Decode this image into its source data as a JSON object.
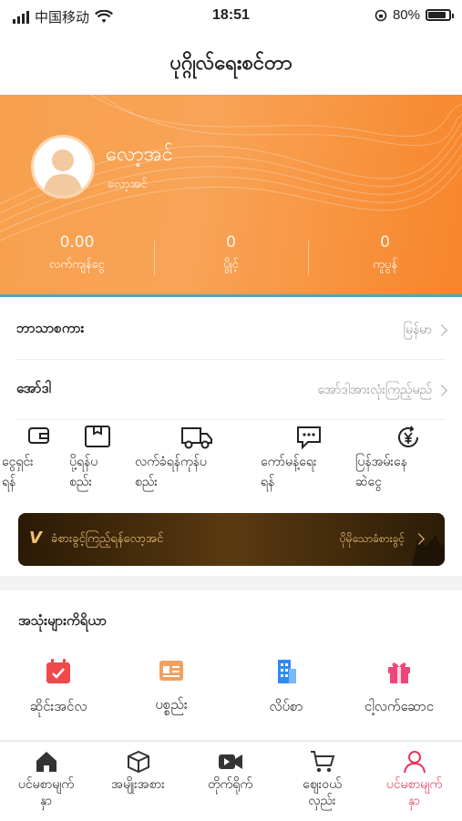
{
  "status": {
    "carrier": "中国移动",
    "time": "18:51",
    "battery": "80%"
  },
  "header": {
    "title": "ပုဂ္ဂိုလ်ရေးစင်တာ"
  },
  "profile": {
    "name": "လော့အင်",
    "subname": "လော့အင်"
  },
  "stats": [
    {
      "value": "0.00",
      "label": "လက်ကျန်ငွေ"
    },
    {
      "value": "0",
      "label": "ပွိုင့်"
    },
    {
      "value": "0",
      "label": "ကူပွန်"
    }
  ],
  "settings": {
    "language_label": "ဘာသာစကား",
    "language_value": "မြန်မာ",
    "order_label": "အော်ဒါ",
    "order_value": "အော်ဒါအားလုံးကြည့်မည်"
  },
  "tools": [
    {
      "label": "ငွေရှင်း\nရန်",
      "icon": "wallet-icon"
    },
    {
      "label": "ပို့ရန်ပ\nစည်း",
      "icon": "package-icon"
    },
    {
      "label": "လက်ခံရန်ကုန်ပ\nစည်း",
      "icon": "truck-icon"
    },
    {
      "label": "ကော်မန့်ရေး\nရန်",
      "icon": "comment-icon"
    },
    {
      "label": "ပြန်အမ်းနေ\nဆဲငွေ",
      "icon": "refund-yen-icon"
    }
  ],
  "vip": {
    "badge": "V",
    "text": "ခံစားခွင့်ကြည့်ရန်လော့အင်",
    "link": "ပိုမိုသောခံစားခွင့်"
  },
  "common_tools": {
    "title": "အသုံးများကိရိယာ",
    "items": [
      {
        "label": "ဆိုင်းအင်လ",
        "icon": "calendar-check-icon",
        "color": "#f0494b"
      },
      {
        "label": "ပစ္စည်း",
        "icon": "id-card-icon",
        "color": "#f0a060"
      },
      {
        "label": "လိပ်စာ",
        "icon": "building-icon",
        "color": "#2f8cf3"
      },
      {
        "label": "ငါ့လက်ဆောင",
        "icon": "gift-icon",
        "color": "#f0457a"
      }
    ]
  },
  "tabbar": [
    {
      "label": "ပင်မစာမျက်\nနှာ",
      "icon": "home-icon",
      "active": false
    },
    {
      "label": "အမျိုးအစား",
      "icon": "cube-icon",
      "active": false
    },
    {
      "label": "တိုက်ရိုက်",
      "icon": "video-icon",
      "active": false
    },
    {
      "label": "ဈေးဝယ်\nလှည်း",
      "icon": "cart-icon",
      "active": false
    },
    {
      "label": "ပင်မစာမျက်\nနှာ",
      "icon": "profile-icon",
      "active": true
    }
  ],
  "colors": {
    "accent": "#f7922f",
    "active_tab": "#e8345a"
  }
}
